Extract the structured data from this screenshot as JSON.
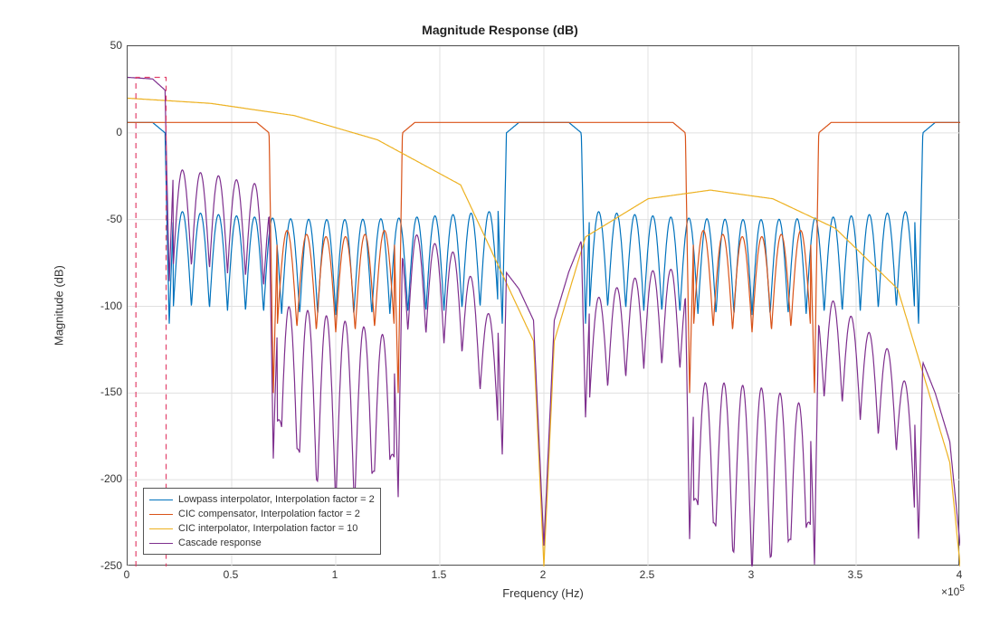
{
  "chart_data": {
    "type": "line",
    "title": "Magnitude Response (dB)",
    "xlabel": "Frequency (Hz)",
    "ylabel": "Magnitude (dB)",
    "x_multiplier_label": "×10",
    "x_multiplier_exp": "5",
    "xlim": [
      0,
      4
    ],
    "ylim": [
      -250,
      50
    ],
    "xticks": [
      0,
      0.5,
      1,
      1.5,
      2,
      2.5,
      3,
      3.5,
      4
    ],
    "yticks": [
      -250,
      -200,
      -150,
      -100,
      -50,
      0,
      50
    ],
    "xtick_labels": [
      "0",
      "0.5",
      "1",
      "1.5",
      "2",
      "2.5",
      "3",
      "3.5",
      "4"
    ],
    "ytick_labels": [
      "-250",
      "-200",
      "-150",
      "-100",
      "-50",
      "0",
      "50"
    ],
    "legend": {
      "entries": [
        {
          "label": "Lowpass interpolator, Interpolation factor = 2",
          "color": "#0072BD"
        },
        {
          "label": "CIC compensator, Interpolation factor = 2",
          "color": "#D95319"
        },
        {
          "label": "CIC interpolator, Interpolation factor = 10",
          "color": "#EDB120"
        },
        {
          "label": "Cascade response",
          "color": "#7E2F8E"
        }
      ]
    },
    "mask": {
      "color": "#E2416A",
      "dash": true,
      "x": [
        0.04,
        0.185
      ],
      "y_top": 32,
      "y_bottom": -250
    },
    "series": [
      {
        "name": "Lowpass interpolator, Interpolation factor = 2",
        "color": "#0072BD",
        "passband": 6,
        "period": 2.0,
        "passband_halfwidth": 0.2,
        "ripple_top": -45,
        "ripple_count_per_gap": 18,
        "notch_depth": -110
      },
      {
        "name": "CIC compensator, Interpolation factor = 2",
        "color": "#D95319",
        "passband": 6,
        "period": 2.0,
        "passband_halfwidth": 0.7,
        "ripple_top": -55,
        "ripple_count_per_gap": 6,
        "notch_depth": -150
      },
      {
        "name": "CIC interpolator, Interpolation factor = 10",
        "color": "#EDB120",
        "type": "cic",
        "values_at_x": [
          [
            0,
            20
          ],
          [
            0.4,
            17
          ],
          [
            0.8,
            10
          ],
          [
            1.2,
            -4
          ],
          [
            1.6,
            -30
          ],
          [
            1.95,
            -120
          ],
          [
            2.0,
            -250
          ],
          [
            2.05,
            -120
          ],
          [
            2.2,
            -60
          ],
          [
            2.5,
            -38
          ],
          [
            2.8,
            -33
          ],
          [
            3.1,
            -38
          ],
          [
            3.4,
            -55
          ],
          [
            3.7,
            -90
          ],
          [
            3.95,
            -190
          ],
          [
            4.0,
            -250
          ]
        ]
      },
      {
        "name": "Cascade response",
        "color": "#7E2F8E",
        "type": "cascade"
      }
    ]
  }
}
